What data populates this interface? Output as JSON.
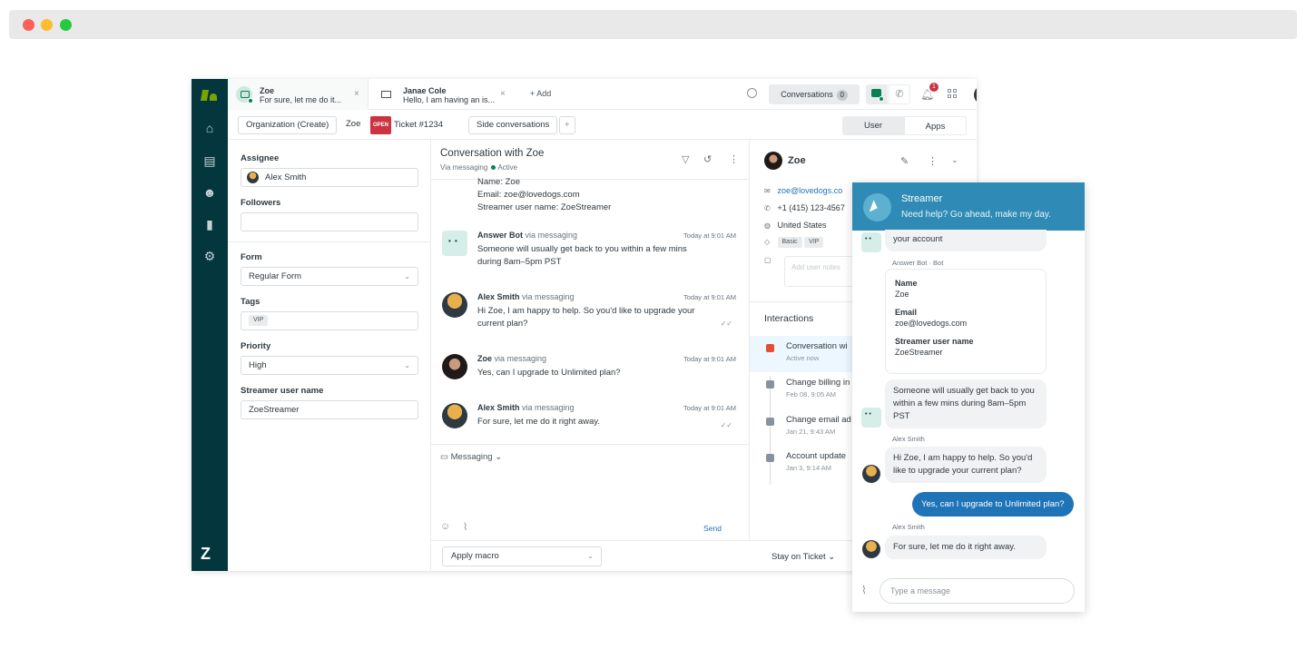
{
  "tabs": [
    {
      "title": "Zoe",
      "preview": "For sure, let me do it...",
      "close": "×"
    },
    {
      "title": "Janae Cole",
      "preview": "Hello, I am having an is...",
      "close": "×"
    }
  ],
  "add_tab": "+ Add",
  "header": {
    "conversations_label": "Conversations",
    "conversations_count": "0",
    "notification_count": "1"
  },
  "crumbs": {
    "organization": "Organization (Create)",
    "user": "Zoe",
    "status": "OPEN",
    "ticket": "Ticket #1234",
    "side": "Side conversations",
    "plus": "+"
  },
  "segments": {
    "user": "User",
    "apps": "Apps"
  },
  "properties": {
    "assignee_label": "Assignee",
    "assignee_value": "Alex Smith",
    "followers_label": "Followers",
    "form_label": "Form",
    "form_value": "Regular Form",
    "tags_label": "Tags",
    "tags": [
      "VIP"
    ],
    "priority_label": "Priority",
    "priority_value": "High",
    "streamer_label": "Streamer user name",
    "streamer_value": "ZoeStreamer"
  },
  "conversation": {
    "title": "Conversation with Zoe",
    "via": "Via messaging",
    "status": "Active",
    "top_text": [
      "Name: Zoe",
      "Email: zoe@lovedogs.com",
      "Streamer user name: ZoeStreamer"
    ],
    "messages": [
      {
        "name": "Answer Bot",
        "via": "via messaging",
        "time": "Today at 9:01 AM",
        "text": "Someone will usually get back to you within a few mins during 8am–5pm PST"
      },
      {
        "name": "Alex Smith",
        "via": "via messaging",
        "time": "Today at 9:01 AM",
        "text": "Hi Zoe, I am happy to help. So you'd like to upgrade your current plan?"
      },
      {
        "name": "Zoe",
        "via": "via messaging",
        "time": "Today at 9:01 AM",
        "text": "Yes, can I upgrade to Unlimited plan?"
      },
      {
        "name": "Alex Smith",
        "via": "via messaging",
        "time": "Today at 9:01 AM",
        "text": "For sure, let me do it right away."
      }
    ],
    "channel": "Messaging",
    "send": "Send"
  },
  "footer": {
    "macro": "Apply macro",
    "stay": "Stay on Ticket"
  },
  "context": {
    "name": "Zoe",
    "email": "zoe@lovedogs.co",
    "phone": "+1 (415) 123-4567",
    "country": "United States",
    "tags": [
      "Basic",
      "VIP"
    ],
    "notes_placeholder": "Add user notes",
    "interactions_title": "Interactions",
    "interactions": [
      {
        "title": "Conversation wi",
        "sub": "Active now"
      },
      {
        "title": "Change billing in",
        "sub": "Feb 08, 9:05 AM"
      },
      {
        "title": "Change email ad",
        "sub": "Jan 21, 9:43 AM"
      },
      {
        "title": "Account update",
        "sub": "Jan 3, 9:14 AM"
      }
    ]
  },
  "widget": {
    "title": "Streamer",
    "subtitle": "Need help? Go ahead, make my day.",
    "partial_bubble": "your account",
    "bot_caption": "Answer Bot · Bot",
    "card": [
      {
        "label": "Name",
        "value": "Zoe"
      },
      {
        "label": "Email",
        "value": "zoe@lovedogs.com"
      },
      {
        "label": "Streamer user name",
        "value": "ZoeStreamer"
      }
    ],
    "bot_message": "Someone will usually get back to you within a few mins during 8am–5pm PST",
    "agent_caption_1": "Alex Smith",
    "agent_message_1": "Hi Zoe, I am happy to help. So you'd like to upgrade your current plan?",
    "user_message": "Yes, can I upgrade to Unlimited plan?",
    "agent_caption_2": "Alex Smith",
    "agent_message_2": "For sure, let me do it right away.",
    "input_placeholder": "Type a message"
  }
}
